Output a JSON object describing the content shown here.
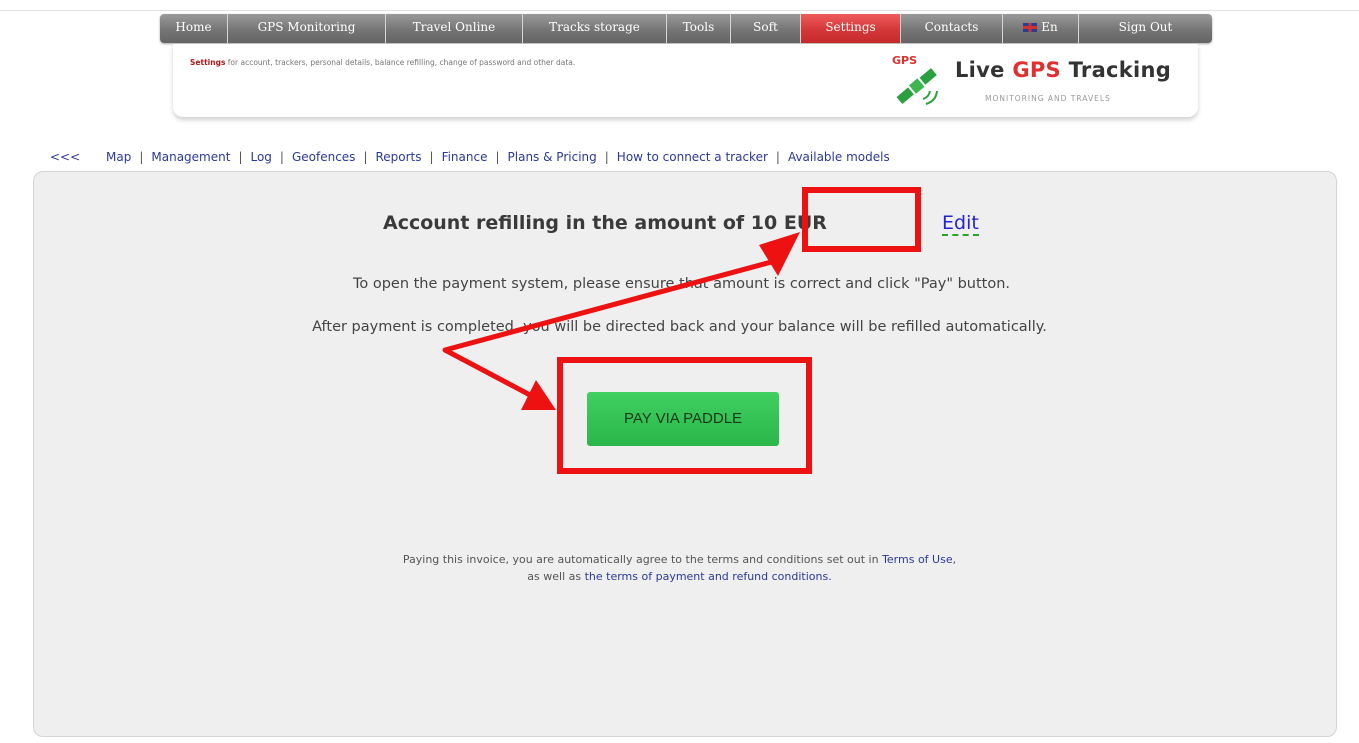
{
  "topnav": {
    "tabs": [
      {
        "label": "Home",
        "active": false
      },
      {
        "label": "GPS Monitoring",
        "active": false
      },
      {
        "label": "Travel Online",
        "active": false
      },
      {
        "label": "Tracks storage",
        "active": false
      },
      {
        "label": "Tools",
        "active": false
      },
      {
        "label": "Soft",
        "active": false
      },
      {
        "label": "Settings",
        "active": true
      },
      {
        "label": "Contacts",
        "active": false
      }
    ],
    "language": "En",
    "sign_out": "Sign Out"
  },
  "header": {
    "desc_bold": "Settings",
    "desc_rest": " for account, trackers, personal details, balance refilling, change of password and other data.",
    "logo_gps_small": "GPS",
    "logo_title_pre": "Live ",
    "logo_title_accent": "GPS",
    "logo_title_post": " Tracking",
    "logo_sub": "MONITORING AND TRAVELS"
  },
  "subnav": {
    "back": "<<<",
    "links": [
      "Map",
      "Management",
      "Log",
      "Geofences",
      "Reports",
      "Finance",
      "Plans & Pricing",
      "How to connect a tracker",
      "Available models"
    ]
  },
  "main": {
    "heading_prefix": "Account refilling in the amount of ",
    "amount": "10 EUR",
    "edit_label": "Edit",
    "instruction_1": "To open the payment system, please ensure that amount is correct and click \"Pay\" button.",
    "instruction_2": "After payment is completed, you will be directed back and your balance will be refilled automatically.",
    "pay_button": "PAY VIA PADDLE",
    "terms_1_pre": "Paying this invoice, you are automatically agree to the terms and conditions set out in ",
    "terms_1_link": "Terms of Use",
    "terms_1_post": ",",
    "terms_2_pre": "as well as ",
    "terms_2_link": "the terms of payment and refund conditions."
  },
  "colors": {
    "nav_gray": "#757575",
    "nav_active": "#d43737",
    "link_blue": "#2b3a9a",
    "button_green": "#2bb64a",
    "annotation_red": "#ee1111"
  }
}
